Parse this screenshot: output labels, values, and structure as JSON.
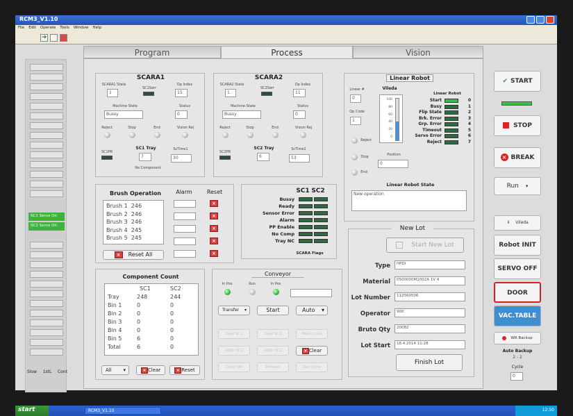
{
  "window": {
    "title": "RCM3_V1.10"
  },
  "menu": [
    "File",
    "Edit",
    "Operate",
    "Tools",
    "Window",
    "Help"
  ],
  "tabs": [
    {
      "label": "Program"
    },
    {
      "label": "Process"
    },
    {
      "label": "Vision"
    }
  ],
  "left_panel": {
    "servo_labels": [
      "SC1 Servo On",
      "SC2 Servo On"
    ],
    "speed": [
      "Slow",
      "1stL",
      "Cont"
    ]
  },
  "scara1": {
    "title": "SCARA1",
    "state_label": "SCARA1 State",
    "state_value": "1",
    "sc1ser_label": "SC1Serr",
    "opindex_label": "Op Index",
    "opindex_value": "15",
    "machine_state_label": "Machine State",
    "machine_state_value": "Bussy",
    "status_label": "Status",
    "status_value": "0",
    "leds": [
      "Reject",
      "Stop",
      "End",
      "Vision Rej"
    ],
    "scpr_label": "SC1PR",
    "tray_label": "SC1 Tray",
    "tray_value": "7",
    "time_label": "ScTime1",
    "time_value": "30",
    "no_component": "No Component"
  },
  "scara2": {
    "title": "SCARA2",
    "state_label": "SCARA2 State",
    "state_value": "1",
    "sc2ser_label": "SC2Serr",
    "opindex_label": "Op Index",
    "opindex_value": "11",
    "machine_state_label": "Machine State",
    "machine_state_value": "Bussy",
    "status_label": "Status",
    "status_value": "0",
    "leds": [
      "Reject",
      "Stop",
      "End",
      "Vision Rej"
    ],
    "scpr_label": "SC2PR",
    "tray_label": "SC2 Tray",
    "tray_value": "6",
    "time_label": "ScTime2",
    "time_value": "53"
  },
  "linear": {
    "title": "Linear Robot",
    "linear_label": "Linear #",
    "linear_value": "0",
    "vileda_label": "Vileda",
    "opcode_label": "Op Code",
    "opcode_value": "1",
    "scale": [
      "100",
      "80",
      "60",
      "40",
      "20",
      "0"
    ],
    "radios": [
      "Reject",
      "Stop",
      "End"
    ],
    "position_label": "Position",
    "position_value": "0",
    "flags_title": "Linear Robot",
    "flags": [
      {
        "label": "Start",
        "n": "0"
      },
      {
        "label": "Busy",
        "n": "1"
      },
      {
        "label": "Flip State",
        "n": "2"
      },
      {
        "label": "Brk. Error",
        "n": "3"
      },
      {
        "label": "Grp. Error",
        "n": "4"
      },
      {
        "label": "Timeout",
        "n": "5"
      },
      {
        "label": "Servo Error",
        "n": "6"
      },
      {
        "label": "Reject",
        "n": "7"
      }
    ],
    "state_title": "Linear Robot State",
    "state_text": "New operation"
  },
  "brush": {
    "title": "Brush Operation",
    "alarm": "Alarm",
    "reset": "Reset",
    "items": [
      "Brush 1  246",
      "Brush 2  246",
      "Brush 3  246",
      "Brush 4  245",
      "Brush 5  245"
    ],
    "reset_all": "Reset All"
  },
  "flags": {
    "header1": "SC1",
    "header2": "SC2",
    "labels": [
      "Bussy",
      "Ready",
      "Sensor Error",
      "Alarm",
      "PP Enable",
      "No Comp",
      "Tray NC"
    ],
    "footer": "SCARA Flags"
  },
  "component": {
    "title": "Component Count",
    "col1": "SC1",
    "col2": "SC2",
    "rows": [
      {
        "name": "Tray",
        "a": "248",
        "b": "244"
      },
      {
        "name": "Bin 1",
        "a": "0",
        "b": "0"
      },
      {
        "name": "Bin 2",
        "a": "0",
        "b": "0"
      },
      {
        "name": "Bin 3",
        "a": "0",
        "b": "0"
      },
      {
        "name": "Bin 4",
        "a": "0",
        "b": "0"
      },
      {
        "name": "Bin 5",
        "a": "6",
        "b": "0"
      },
      {
        "name": "Total",
        "a": "6",
        "b": "0"
      }
    ],
    "select": "All",
    "clear": "Clear",
    "reset": "Reset"
  },
  "conveyor": {
    "title": "Conveyor",
    "leds": [
      "In Pos",
      "Run",
      "In Pos"
    ],
    "transfer": "Transfer",
    "start": "Start",
    "auto": "Auto",
    "buttons": [
      "Stop SC1",
      "Stop SC2",
      "Mech Lock",
      "Align SC1",
      "Align SC2",
      "Clear",
      "Conv ON",
      "Prevent",
      "Run Conv"
    ]
  },
  "newlot": {
    "title": "New Lot",
    "start_new": "Start New Lot",
    "fields": [
      {
        "label": "Type",
        "value": "HPDI"
      },
      {
        "label": "Material",
        "value": "0500000M1002A  1V 4"
      },
      {
        "label": "Lot Number",
        "value": "112560506"
      },
      {
        "label": "Operator",
        "value": "900"
      },
      {
        "label": "Bruto Qty",
        "value": "20082"
      },
      {
        "label": "Lot Start",
        "value": "18.4.2014 11:28"
      }
    ],
    "finish": "Finish Lot"
  },
  "right": {
    "start": "START",
    "stop": "STOP",
    "break": "BREAK",
    "run": "Run",
    "vileda": "Vileda",
    "robot_init": "Robot INIT",
    "servo_off": "SERVO OFF",
    "door": "DOOR",
    "vac_table": "VAC.TABLE",
    "wr_backup": "WR Backup",
    "auto_backup": "Auto Backup",
    "auto_backup_val": "2 - 2",
    "cycle_label": "Cycle",
    "cycle_value": "0"
  },
  "taskbar": {
    "start": "start",
    "item": "RCM3_V1.10",
    "clock": "12:50"
  }
}
